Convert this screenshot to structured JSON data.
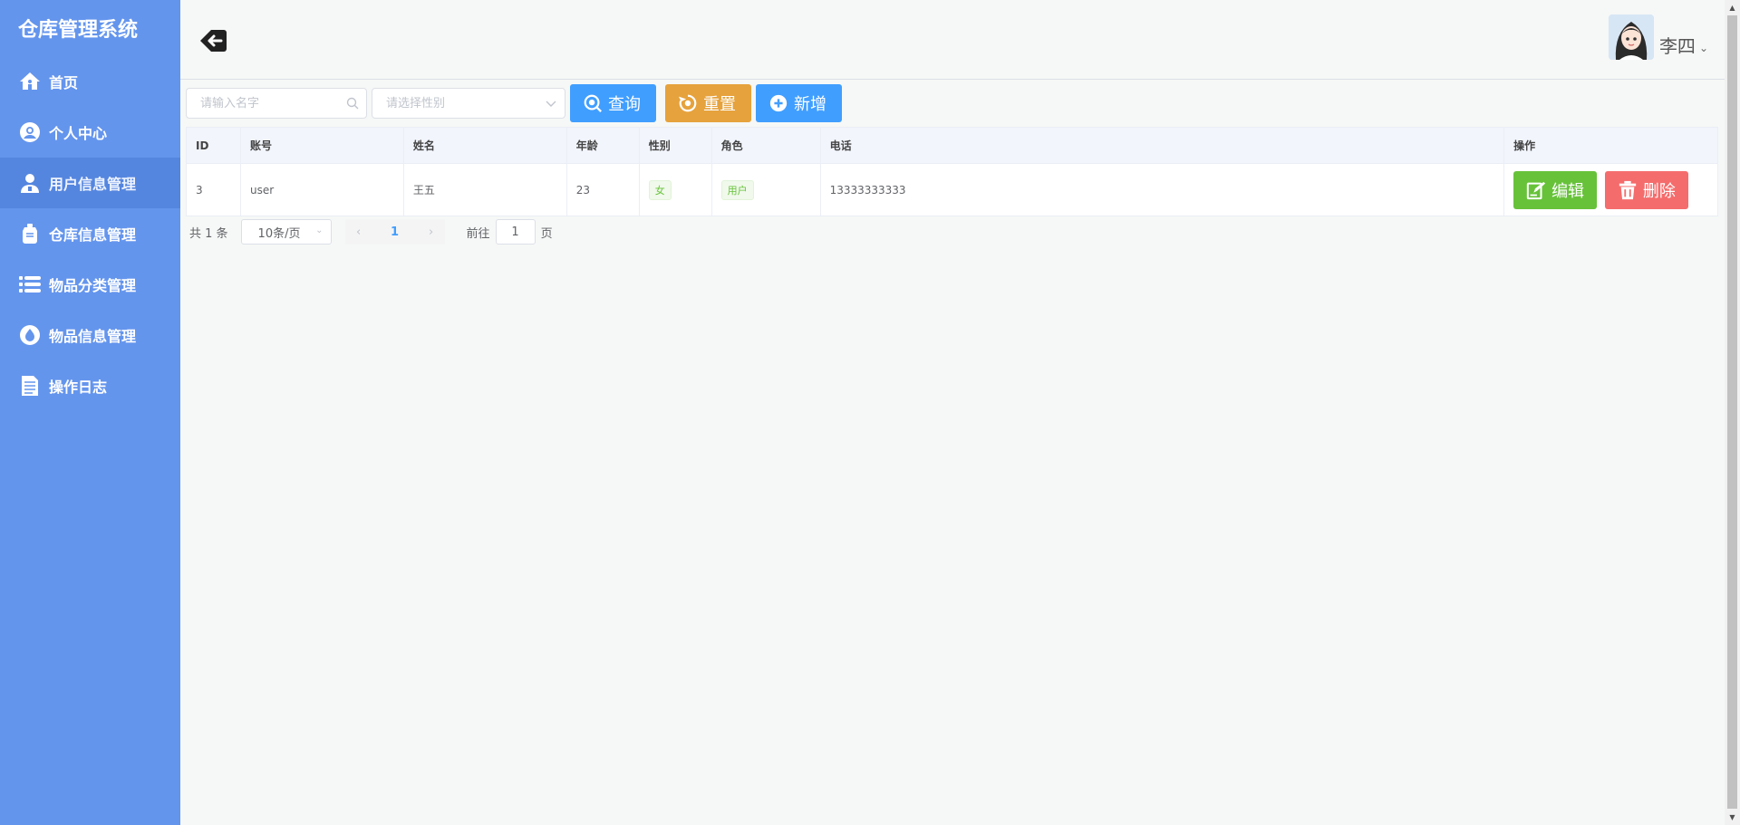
{
  "app": {
    "title": "仓库管理系统"
  },
  "sidebar": {
    "items": [
      {
        "label": "首页",
        "icon": "home-icon"
      },
      {
        "label": "个人中心",
        "icon": "profile-icon"
      },
      {
        "label": "用户信息管理",
        "icon": "user-icon",
        "active": true
      },
      {
        "label": "仓库信息管理",
        "icon": "warehouse-icon"
      },
      {
        "label": "物品分类管理",
        "icon": "list-icon"
      },
      {
        "label": "物品信息管理",
        "icon": "drop-icon"
      },
      {
        "label": "操作日志",
        "icon": "document-icon"
      }
    ]
  },
  "header": {
    "username": "李四"
  },
  "toolbar": {
    "name_placeholder": "请输入名字",
    "gender_placeholder": "请选择性别",
    "query_label": "查询",
    "reset_label": "重置",
    "add_label": "新增"
  },
  "table": {
    "columns": [
      "ID",
      "账号",
      "姓名",
      "年龄",
      "性别",
      "角色",
      "电话",
      "操作"
    ],
    "rows": [
      {
        "id": "3",
        "account": "user",
        "name": "王五",
        "age": "23",
        "gender": "女",
        "role": "用户",
        "phone": "13333333333",
        "edit_label": "编辑",
        "delete_label": "删除"
      }
    ]
  },
  "pagination": {
    "total_text": "共 1 条",
    "page_size": "10条/页",
    "current_page": "1",
    "goto_prefix": "前往",
    "goto_value": "1",
    "goto_suffix": "页"
  },
  "colors": {
    "sidebar": "#6495ed",
    "primary": "#409eff",
    "warning": "#e6a23c",
    "success": "#67c23a",
    "danger": "#f56c6c"
  }
}
